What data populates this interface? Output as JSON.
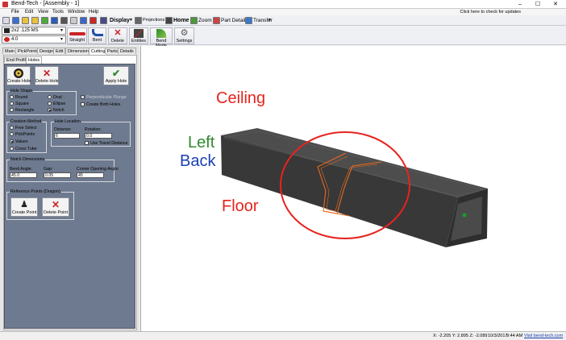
{
  "window": {
    "title": "Bend-Tech - [Assembly - 1]"
  },
  "menu": {
    "items": [
      "File",
      "Edit",
      "View",
      "Tools",
      "Window",
      "Help"
    ],
    "update_notice": "Click here to check for updates"
  },
  "toolbar1": {
    "display": "Display",
    "projections": "Projections",
    "home": "Home",
    "zoom": "Zoom",
    "part_details": "Part Details",
    "transfer": "Transfer"
  },
  "toolbar2": {
    "material": "2x2 .125 MS",
    "length": "4.0",
    "buttons": {
      "straight": "Straight",
      "bent": "Bent",
      "delete": "Delete",
      "entities": "Entities",
      "bend_mode": "Bend Mode",
      "settings": "Settings"
    }
  },
  "tabs_main": [
    "Main",
    "PickPoints",
    "Design",
    "Edit",
    "Dimensions",
    "Cutting",
    "Parts",
    "Details"
  ],
  "tabs_sub": [
    "End Profiles",
    "Holes"
  ],
  "holes": {
    "create_hole": "Create Hole",
    "delete_hole": "Delete Hole",
    "apply_hole": "Apply Hole",
    "hole_shape": {
      "title": "Hole Shape",
      "options": [
        "Round",
        "Square",
        "Rectangle",
        "Oval",
        "Ellipse",
        "Notch"
      ],
      "perpendicular_plunge": "Perpendicular Plunge",
      "create_both_holes": "Create Both Holes"
    },
    "creation_method": {
      "title": "Creation Method",
      "options": [
        "Free Select",
        "PickPoints",
        "Values",
        "Cross Tube"
      ]
    },
    "hole_location": {
      "title": "Hole Location",
      "distance_label": "Distance:",
      "distance_value": "6",
      "rotation_label": "Rotation:",
      "rotation_value": "0.0",
      "use_travel_distance": "Use Travel Distance"
    },
    "notch_dimensions": {
      "title": "Notch Dimensions",
      "bend_angle_label": "Bend Angle:",
      "bend_angle_value": "45.0",
      "gap_label": "Gap:",
      "gap_value": "0.05",
      "corner_label": "Corner Opening Angle:",
      "corner_value": "45"
    },
    "reference_points": {
      "title": "Reference Points (Dragon)",
      "create_point": "Create Point",
      "delete_point": "Delete Point"
    }
  },
  "viewport": {
    "ceiling": "Ceiling",
    "left": "Left",
    "back": "Back",
    "floor": "Floor"
  },
  "colors": {
    "ceiling": "#e8231e",
    "left": "#2e8b2e",
    "back": "#1b3fb3",
    "floor": "#e8231e",
    "tube": "#3d3d3d",
    "notch": "#e86a1e",
    "circle": "#e8231e"
  },
  "status": {
    "coords": "X: -2.205  Y: 2.895  Z: -2.089",
    "date": "10/3/2017",
    "time": "9:44 AM",
    "link": "Visit bend-tech.com"
  }
}
